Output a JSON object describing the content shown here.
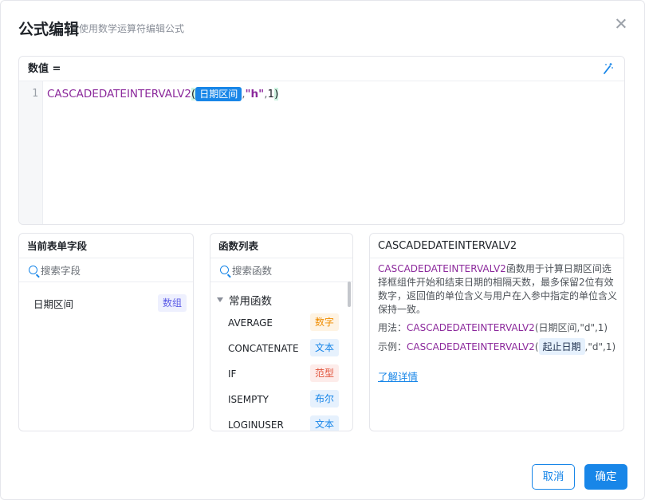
{
  "dialog": {
    "title": "公式编辑",
    "subtitle": "使用数学运算符编辑公式"
  },
  "editor": {
    "label": "数值 =",
    "line_number": "1",
    "formula": {
      "function": "CASCADEDATEINTERVALV2",
      "open_paren": "(",
      "field": "日期区间",
      "sep1": ",",
      "string_arg": "\"h\"",
      "sep2": ",",
      "number_arg": "1",
      "close_paren": ")"
    }
  },
  "fields_panel": {
    "title": "当前表单字段",
    "search_placeholder": "搜索字段",
    "fields": [
      {
        "name": "日期区间",
        "type": "数组"
      }
    ]
  },
  "functions_panel": {
    "title": "函数列表",
    "search_placeholder": "搜索函数",
    "group": "常用函数",
    "functions": [
      {
        "name": "AVERAGE",
        "type": "数字",
        "color": "orange"
      },
      {
        "name": "CONCATENATE",
        "type": "文本",
        "color": "blue"
      },
      {
        "name": "IF",
        "type": "范型",
        "color": "red"
      },
      {
        "name": "ISEMPTY",
        "type": "布尔",
        "color": "blue"
      },
      {
        "name": "LOGINUSER",
        "type": "文本",
        "color": "blue"
      }
    ]
  },
  "help_panel": {
    "title": "CASCADEDATEINTERVALV2",
    "desc_fn": "CASCADEDATEINTERVALV2",
    "description": "函数用于计算日期区间选择框组件开始和结束日期的相隔天数，最多保留2位有效数字，返回值的单位含义与用户在入参中指定的单位含义保持一致。",
    "usage_label": "用法：",
    "usage_fn": "CASCADEDATEINTERVALV2",
    "usage_args": "(日期区间,\"d\",1)",
    "example_label": "示例：",
    "example_fn": "CASCADEDATEINTERVALV2",
    "example_open": "(",
    "example_chip": "起止日期",
    "example_rest": ",\"d\",1)",
    "learn_more": "了解详情"
  },
  "buttons": {
    "cancel": "取消",
    "ok": "确定"
  },
  "colors": {
    "primary": "#1886e8",
    "function": "#8c2a9c",
    "paren_highlight": "#cdf3e0"
  }
}
